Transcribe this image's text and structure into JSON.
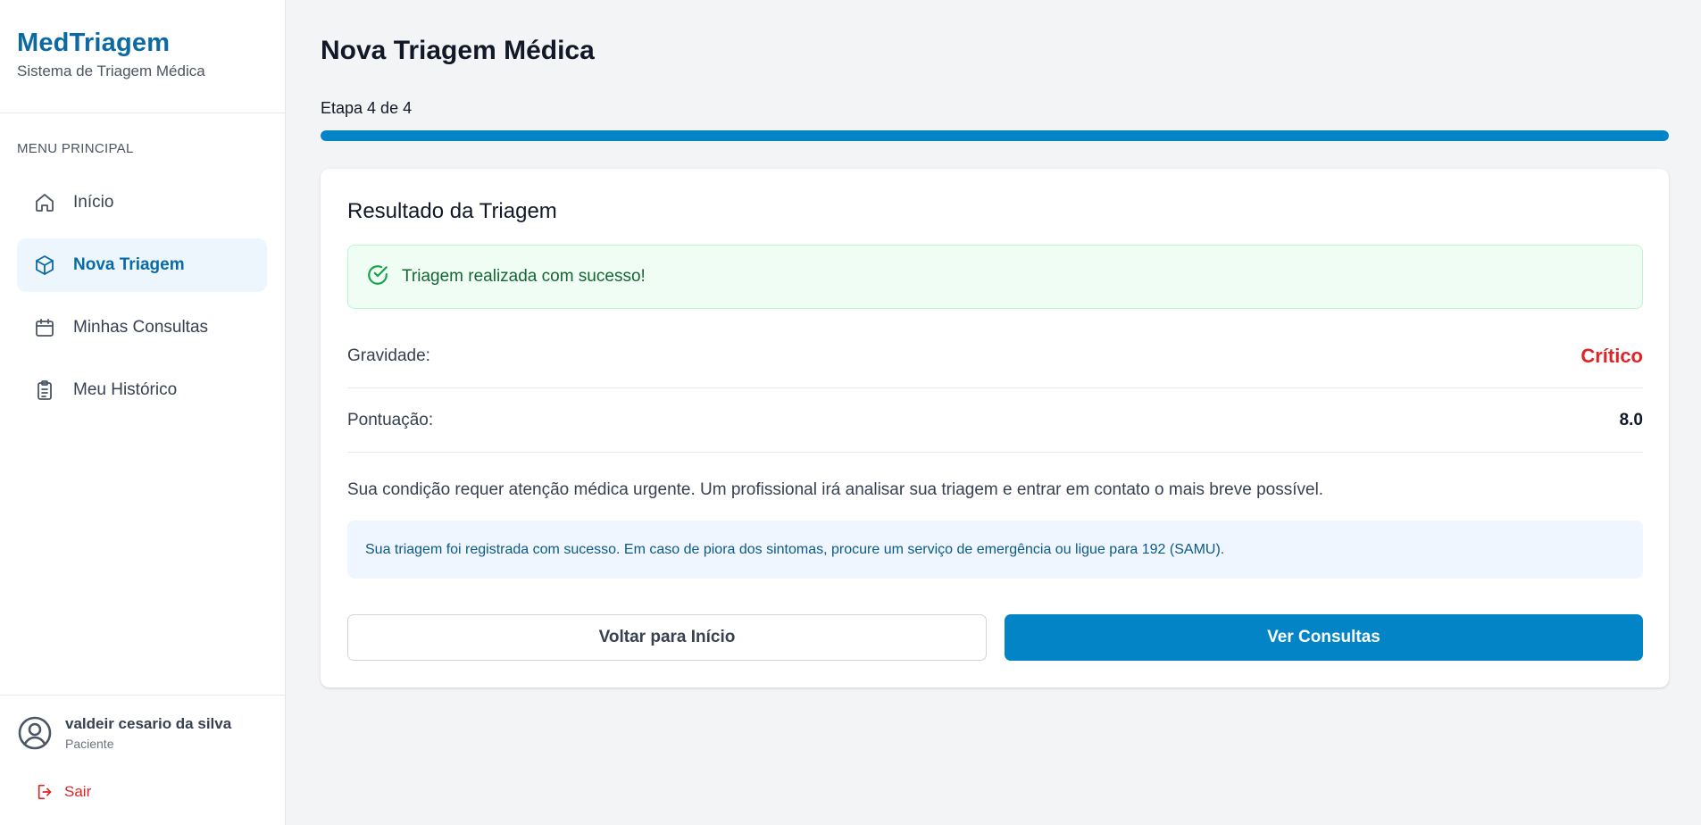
{
  "brand": {
    "title": "MedTriagem",
    "subtitle": "Sistema de Triagem Médica"
  },
  "sidebar": {
    "menu_label": "MENU PRINCIPAL",
    "items": [
      {
        "label": "Início",
        "icon": "home-icon",
        "active": false
      },
      {
        "label": "Nova Triagem",
        "icon": "cube-icon",
        "active": true
      },
      {
        "label": "Minhas Consultas",
        "icon": "calendar-icon",
        "active": false
      },
      {
        "label": "Meu Histórico",
        "icon": "clipboard-icon",
        "active": false
      }
    ],
    "user": {
      "name": "valdeir cesario da silva",
      "role": "Paciente"
    },
    "logout_label": "Sair"
  },
  "main": {
    "title": "Nova Triagem Médica",
    "step_label": "Etapa 4 de 4",
    "progress": 1.0,
    "card": {
      "title": "Resultado da Triagem",
      "success_message": "Triagem realizada com sucesso!",
      "severity_label": "Gravidade:",
      "severity_value": "Crítico",
      "score_label": "Pontuação:",
      "score_value": "8.0",
      "description": "Sua condição requer atenção médica urgente. Um profissional irá analisar sua triagem e entrar em contato o mais breve possível.",
      "info_note": "Sua triagem foi registrada com sucesso. Em caso de piora dos sintomas, procure um serviço de emergência ou ligue para 192 (SAMU).",
      "back_button": "Voltar para Início",
      "appointments_button": "Ver Consultas"
    }
  },
  "colors": {
    "brand": "#0b6aa2",
    "primary": "#0284c7",
    "critical": "#dc2626",
    "success": "#16a34a",
    "background": "#f3f4f6"
  }
}
